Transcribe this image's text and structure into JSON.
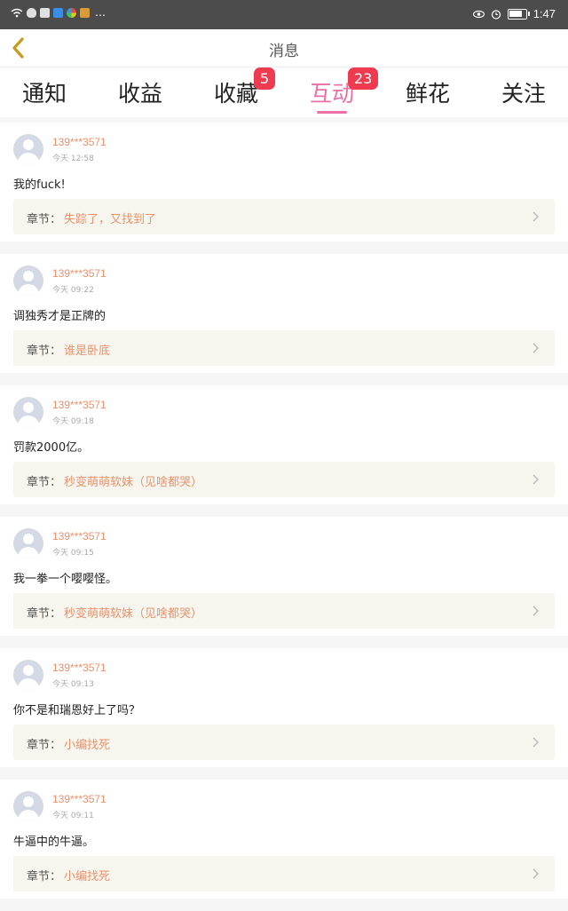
{
  "status_bar": {
    "left_icons": [
      "wifi-icon",
      "qq-icon",
      "mail-icon",
      "app-k-icon",
      "pinwheel-icon",
      "cat-icon",
      "more-icon"
    ],
    "more": "…",
    "time": "1:47",
    "battery_level": 0.8
  },
  "navbar": {
    "title": "消息"
  },
  "tabs": [
    {
      "label": "通知",
      "badge": ""
    },
    {
      "label": "收益",
      "badge": ""
    },
    {
      "label": "收藏",
      "badge": "5"
    },
    {
      "label": "互动",
      "badge": "23",
      "active": true
    },
    {
      "label": "鲜花",
      "badge": ""
    },
    {
      "label": "关注",
      "badge": ""
    }
  ],
  "messages": [
    {
      "user": "139***3571",
      "time": "今天 12:58",
      "text": "我的fuck!",
      "chapter_label": "章节：",
      "chapter": "失踪了，又找到了"
    },
    {
      "user": "139***3571",
      "time": "今天 09:22",
      "text": "调独秀才是正牌的",
      "chapter_label": "章节：",
      "chapter": "谁是卧底"
    },
    {
      "user": "139***3571",
      "time": "今天 09:18",
      "text": "罚款2000亿。",
      "chapter_label": "章节：",
      "chapter": "秒变萌萌软妹（见啥都哭）"
    },
    {
      "user": "139***3571",
      "time": "今天 09:15",
      "text": "我一拳一个嘤嘤怪。",
      "chapter_label": "章节：",
      "chapter": "秒变萌萌软妹（见啥都哭）"
    },
    {
      "user": "139***3571",
      "time": "今天 09:13",
      "text": "你不是和瑞恩好上了吗？",
      "chapter_label": "章节：",
      "chapter": "小编找死"
    },
    {
      "user": "139***3571",
      "time": "今天 09:11",
      "text": "牛逼中的牛逼。",
      "chapter_label": "章节：",
      "chapter": "小编找死"
    }
  ],
  "colors": {
    "accent": "#ec6fa6",
    "badge": "#ee3b4f",
    "username": "#e8926d",
    "back_arrow": "#c99a1e"
  }
}
